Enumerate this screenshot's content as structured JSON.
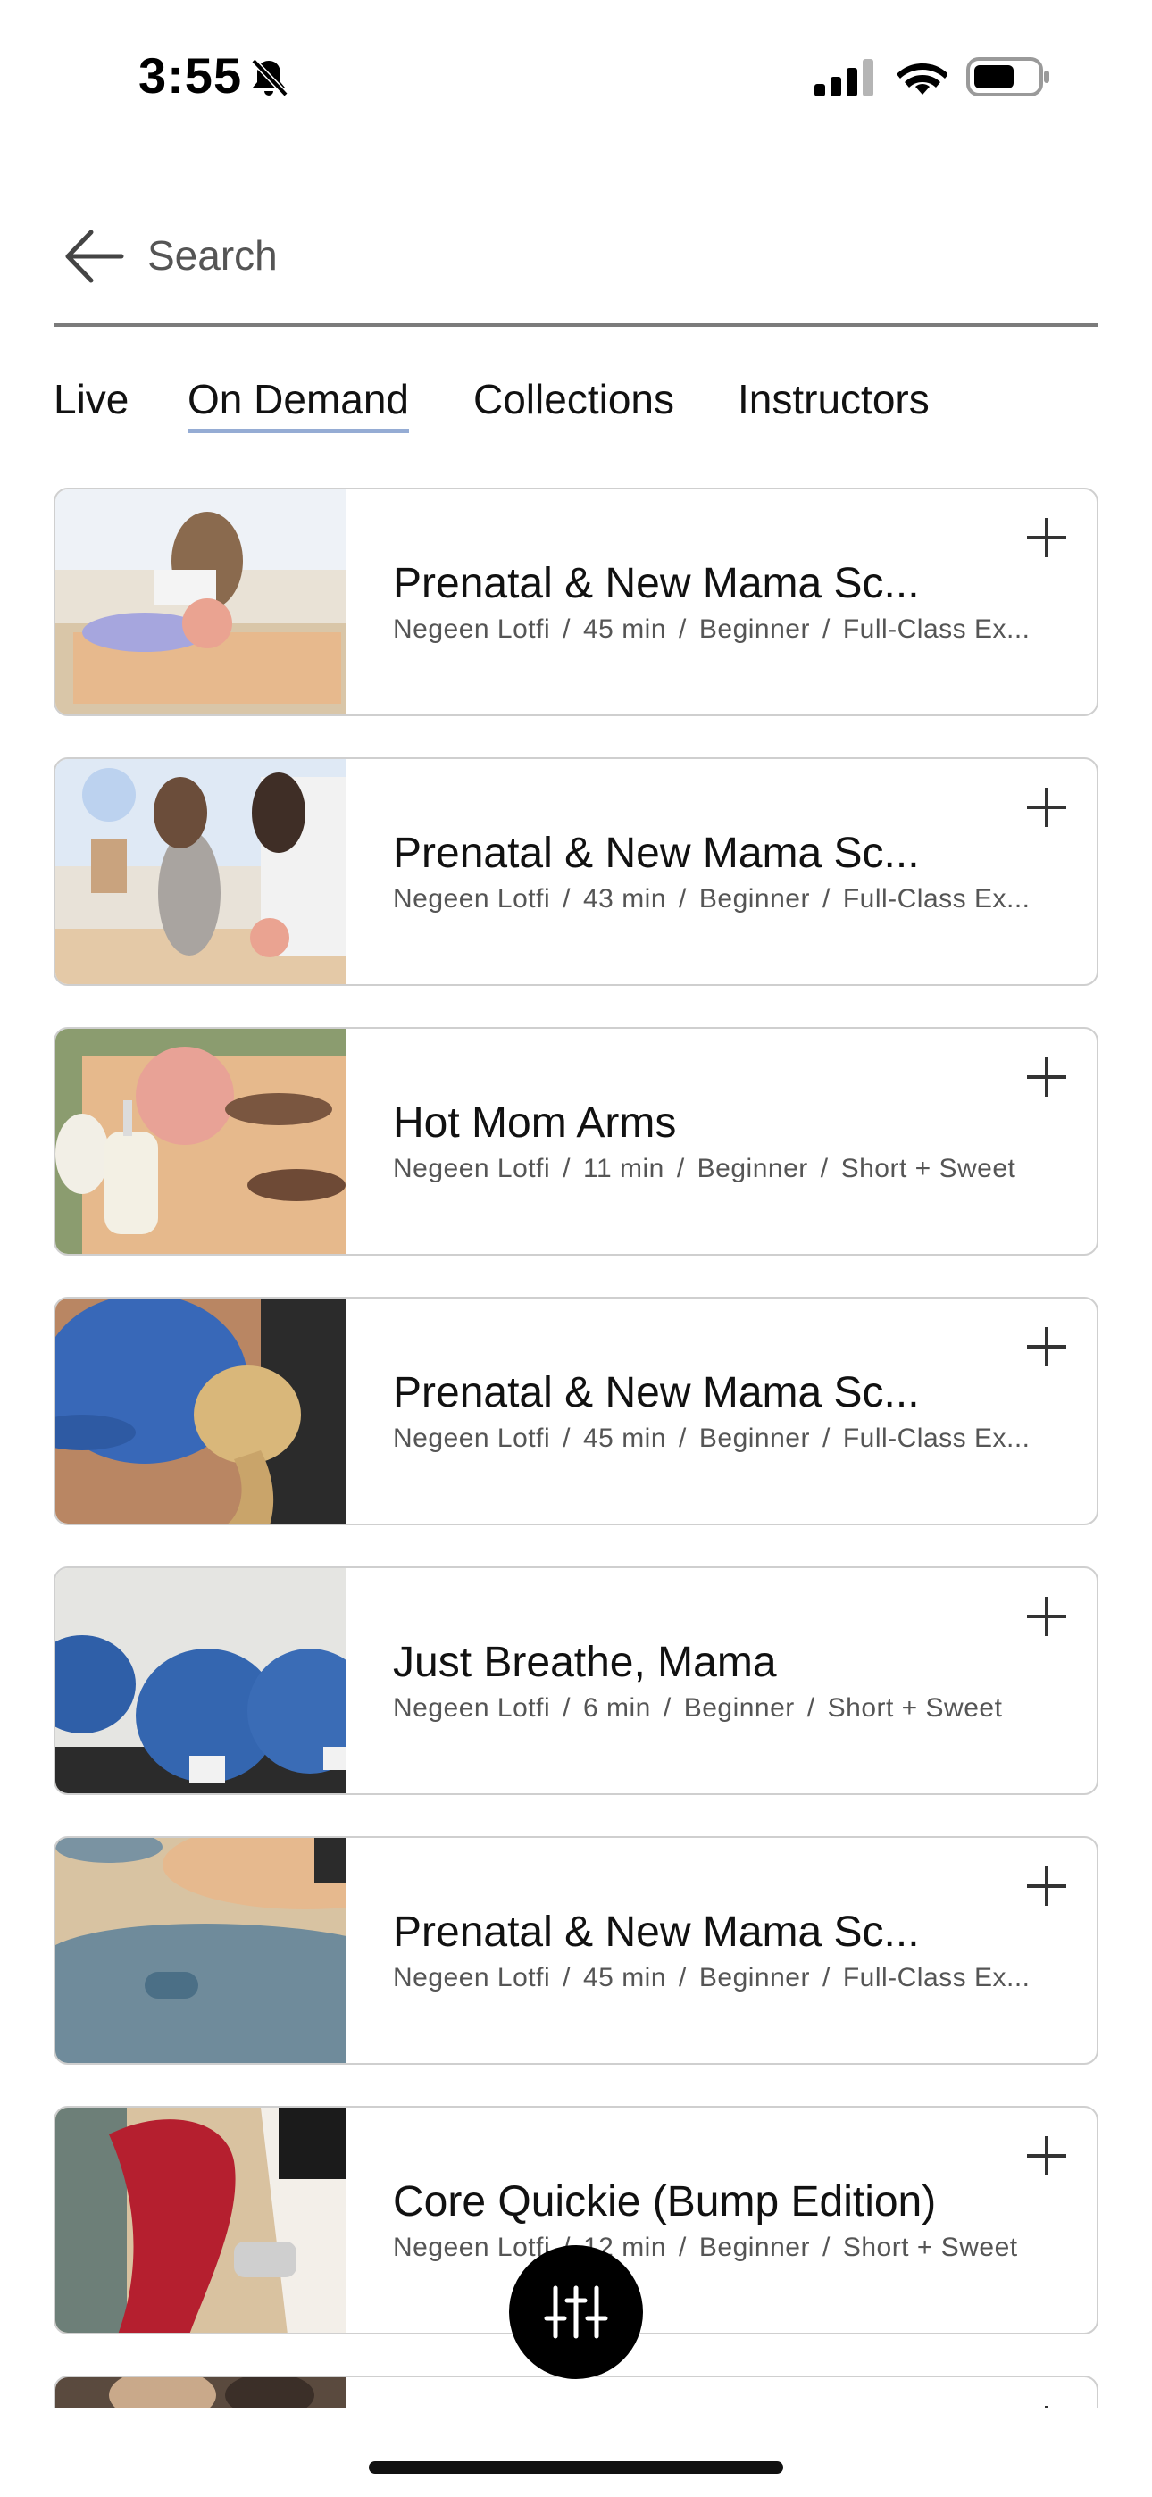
{
  "status_bar": {
    "time": "3:55",
    "icons": [
      "bell-slash-icon",
      "signal-icon",
      "wifi-icon",
      "battery-icon"
    ]
  },
  "search": {
    "placeholder": "Search",
    "back_icon": "arrow-left-icon"
  },
  "tabs": [
    {
      "label": "Live",
      "active": false
    },
    {
      "label": "On Demand",
      "active": true
    },
    {
      "label": "Collections",
      "active": false
    },
    {
      "label": "Instructors",
      "active": false
    }
  ],
  "accent_color": "#95acd4",
  "classes": [
    {
      "title": "Prenatal & New Mama Sc...",
      "instructor": "Negeen Lotfi",
      "duration": "45 min",
      "level": "Beginner",
      "category": "Full-Class Ex...",
      "thumb_icon": "woman-on-mat-with-ball"
    },
    {
      "title": "Prenatal & New Mama Sc...",
      "instructor": "Negeen Lotfi",
      "duration": "43 min",
      "level": "Beginner",
      "category": "Full-Class Ex...",
      "thumb_icon": "women-kneeling-stretch"
    },
    {
      "title": "Hot Mom Arms",
      "instructor": "Negeen Lotfi",
      "duration": "11 min",
      "level": "Beginner",
      "category": "Short + Sweet",
      "thumb_icon": "ball-and-tumbler-on-mat"
    },
    {
      "title": "Prenatal & New Mama Sc...",
      "instructor": "Negeen Lotfi",
      "duration": "45 min",
      "level": "Beginner",
      "category": "Full-Class Ex...",
      "thumb_icon": "blue-cap-hair-bun"
    },
    {
      "title": "Just Breathe, Mama",
      "instructor": "Negeen Lotfi",
      "duration": "6 min",
      "level": "Beginner",
      "category": "Short + Sweet",
      "thumb_icon": "hot-mom-club-caps"
    },
    {
      "title": "Prenatal & New Mama Sc...",
      "instructor": "Negeen Lotfi",
      "duration": "45 min",
      "level": "Beginner",
      "category": "Full-Class Ex...",
      "thumb_icon": "mats-and-weight"
    },
    {
      "title": "Core Quickie (Bump Edition)",
      "instructor": "Negeen Lotfi",
      "duration": "12 min",
      "level": "Beginner",
      "category": "Short + Sweet",
      "thumb_icon": "red-leggings-dumbbell"
    }
  ],
  "filter_button": {
    "icon": "sliders-icon"
  },
  "separator": "/"
}
